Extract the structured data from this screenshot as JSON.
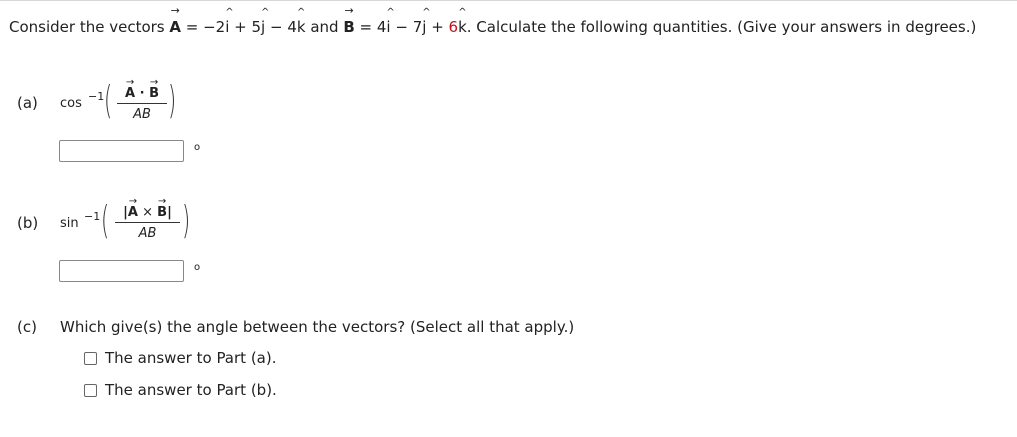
{
  "problem": {
    "prefix": "Consider the vectors",
    "vecA": "A",
    "eqA_part1": " = −2",
    "i_hat": "i",
    "eqA_part2": " + 5",
    "j_hat": "j",
    "eqA_part3": " − ",
    "eqA_k_coeff": "4",
    "k_hat": "k",
    "and": " and ",
    "vecB": "B",
    "eqB_part1": " = 4",
    "eqB_part2": " − 7",
    "eqB_part3": " + ",
    "eqB_k_coeff": "6",
    "suffix": ". Calculate the following quantities. (Give your answers in degrees.)"
  },
  "part_a": {
    "label": "(a)",
    "fn": "cos",
    "sup": "−1",
    "numerator_A": "A",
    "dot": " · ",
    "numerator_B": "B",
    "denominator": "AB",
    "degree_symbol": "o",
    "answer_value": ""
  },
  "part_b": {
    "label": "(b)",
    "fn": "sin",
    "sup": "−1",
    "num_open": "|",
    "numerator_A": "A",
    "cross": " × ",
    "numerator_B": "B",
    "num_close": "|",
    "denominator": "AB",
    "degree_symbol": "o",
    "answer_value": ""
  },
  "part_c": {
    "label": "(c)",
    "question": "Which give(s) the angle between the vectors? (Select all that apply.)",
    "options": [
      {
        "label": "The answer to Part (a).",
        "checked": false
      },
      {
        "label": "The answer to Part (b).",
        "checked": false
      }
    ]
  },
  "colors": {
    "highlight": "#c4111b",
    "text": "#222222",
    "border": "#888888"
  }
}
